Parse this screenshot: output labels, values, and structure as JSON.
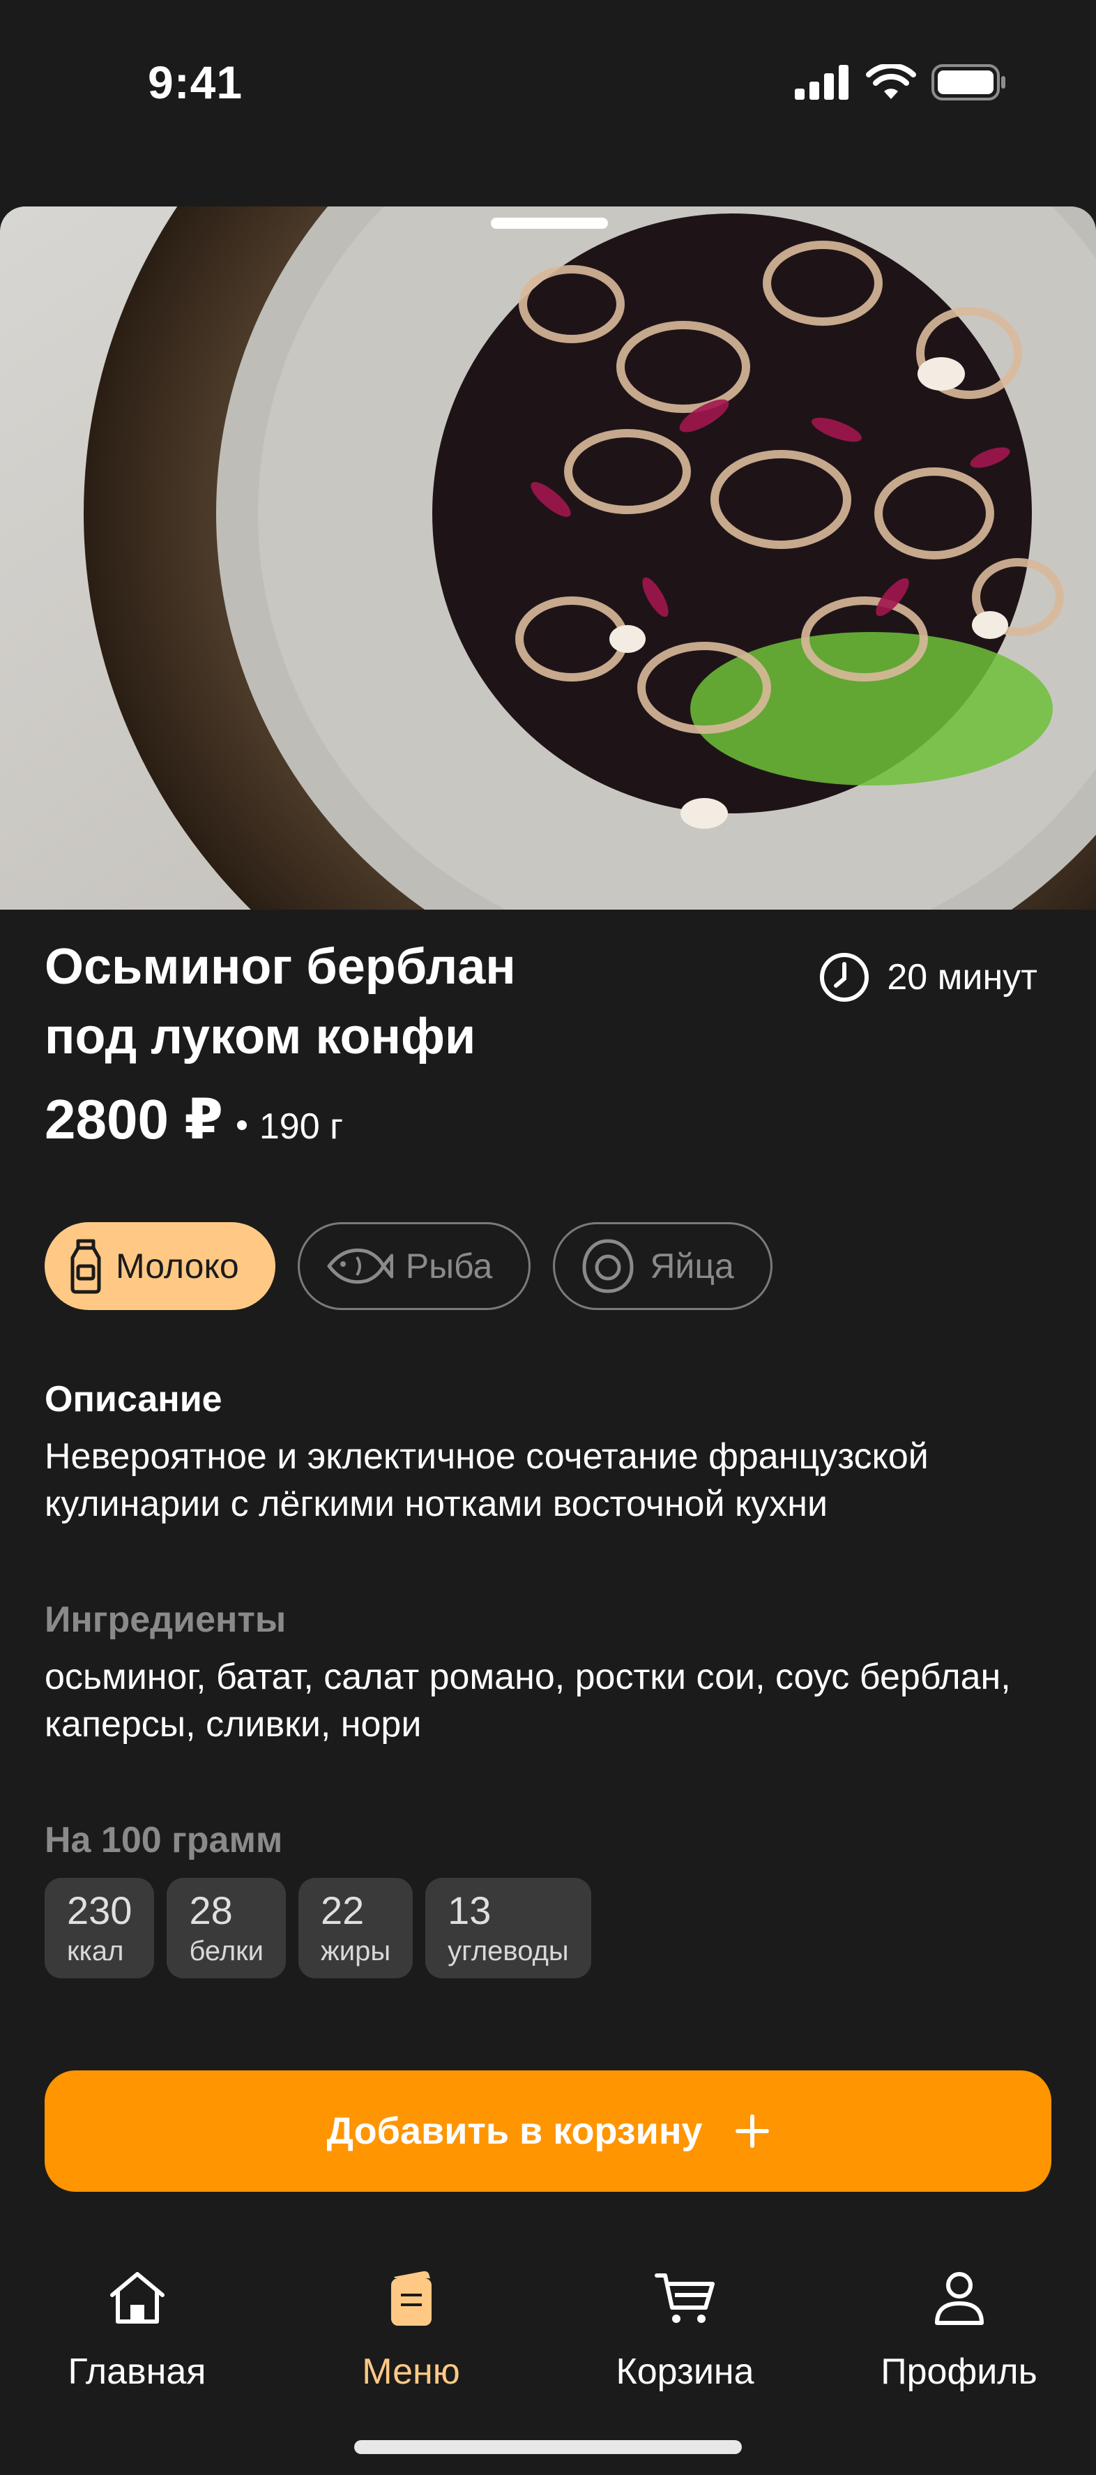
{
  "status_bar": {
    "time": "9:41"
  },
  "dish": {
    "title": "Осьминог берблан\nпод луком конфи",
    "cook_time": "20 минут",
    "price": "2800 ₽",
    "weight": "190 г"
  },
  "allergens": [
    {
      "label": "Молоко",
      "icon": "milk-bottle-icon",
      "active": true
    },
    {
      "label": "Рыба",
      "icon": "fish-icon",
      "active": false
    },
    {
      "label": "Яйца",
      "icon": "egg-icon",
      "active": false
    }
  ],
  "description": {
    "title": "Описание",
    "text": "Невероятное и эклектичное сочетание французской кулинарии с лёгкими нотками восточной кухни"
  },
  "ingredients": {
    "title": "Ингредиенты",
    "text": "осьминог, батат, салат романо, ростки сои, соус берблан, каперсы, сливки,  нори"
  },
  "nutrition": {
    "title": "На 100 грамм",
    "items": [
      {
        "value": "230",
        "label": "ккал"
      },
      {
        "value": "28",
        "label": "белки"
      },
      {
        "value": "22",
        "label": "жиры"
      },
      {
        "value": "13",
        "label": "углеводы"
      }
    ]
  },
  "cta": {
    "label": "Добавить в корзину",
    "icon": "plus-icon"
  },
  "tabbar": [
    {
      "label": "Главная",
      "icon": "home-icon",
      "active": false
    },
    {
      "label": "Меню",
      "icon": "menu-icon",
      "active": true
    },
    {
      "label": "Корзина",
      "icon": "cart-icon",
      "active": false
    },
    {
      "label": "Профиль",
      "icon": "profile-icon",
      "active": false
    }
  ],
  "colors": {
    "background": "#1b1b1b",
    "accent": "#ff9500",
    "accent_light": "#ffc985",
    "chip_muted": "#8a8a8a",
    "card": "#3a3a3a"
  }
}
